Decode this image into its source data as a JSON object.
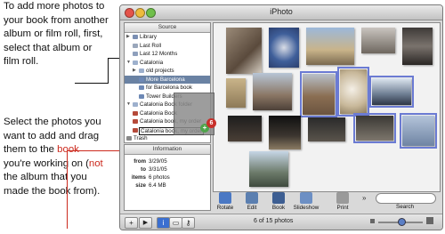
{
  "instructions": {
    "p1": "To add more photos to your book from another album or film roll, first, select that album or film roll.",
    "p2_a": "Select the photos you want to add and drag them to the ",
    "p2_book": "book",
    "p2_b": " you're working on (",
    "p2_not": "not",
    "p2_c": " the album that you made the book from)."
  },
  "window": {
    "title": "iPhoto"
  },
  "source": {
    "header": "Source",
    "items": [
      {
        "label": "Library",
        "icon": "library-icon"
      },
      {
        "label": "Last Roll",
        "icon": "roll-icon"
      },
      {
        "label": "Last 12 Months",
        "icon": "calendar-icon"
      },
      {
        "label": "Catalonia",
        "icon": "folder-icon"
      },
      {
        "label": "old projects",
        "icon": "folder-icon"
      },
      {
        "label": "More Barcelona",
        "icon": "album-icon"
      },
      {
        "label": "for Barcelona book",
        "icon": "album-icon"
      },
      {
        "label": "Tower Builders",
        "icon": "album-icon"
      },
      {
        "label": "Catalonia Book folder",
        "icon": "folder-icon"
      },
      {
        "label": "Catalonia Book",
        "icon": "book-icon"
      },
      {
        "label": "Catalonia book, my order",
        "icon": "book-icon"
      },
      {
        "label": "Catalonia book, my order",
        "icon": "book-icon"
      },
      {
        "label": "Trash",
        "icon": "trash-icon"
      }
    ]
  },
  "drag": {
    "count": "6",
    "plus": "+"
  },
  "info": {
    "header": "Information",
    "from_label": "from",
    "from_value": "3/29/05",
    "to_label": "to",
    "to_value": "3/31/05",
    "items_label": "items",
    "items_value": "6 photos",
    "size_label": "size",
    "size_value": "6.4 MB"
  },
  "toolbar": {
    "rotate": "Rotate",
    "edit": "Edit",
    "book": "Book",
    "slideshow": "Slideshow",
    "print": "Print",
    "more": "»",
    "search": "Search"
  },
  "status": {
    "text": "6 of 15 photos"
  },
  "bottom_buttons": {
    "add": "+",
    "play": "▶",
    "info": "i",
    "calendar": "▭",
    "keywords": "⚷"
  },
  "colors": {
    "accent": "#cc2a1e",
    "selection": "#6b7bd3",
    "source_selection": "#6a82a3"
  },
  "photos": [
    {
      "id": "p1",
      "selected": false
    },
    {
      "id": "p2",
      "selected": false
    },
    {
      "id": "p3",
      "selected": false
    },
    {
      "id": "p4",
      "selected": false
    },
    {
      "id": "p5",
      "selected": false
    },
    {
      "id": "p6",
      "selected": false
    },
    {
      "id": "p7",
      "selected": false
    },
    {
      "id": "p8",
      "selected": true
    },
    {
      "id": "p9",
      "selected": true
    },
    {
      "id": "p10",
      "selected": true
    },
    {
      "id": "p11",
      "selected": false
    },
    {
      "id": "p12",
      "selected": false
    },
    {
      "id": "p13",
      "selected": false
    },
    {
      "id": "p14",
      "selected": true
    },
    {
      "id": "p15",
      "selected": true
    }
  ]
}
